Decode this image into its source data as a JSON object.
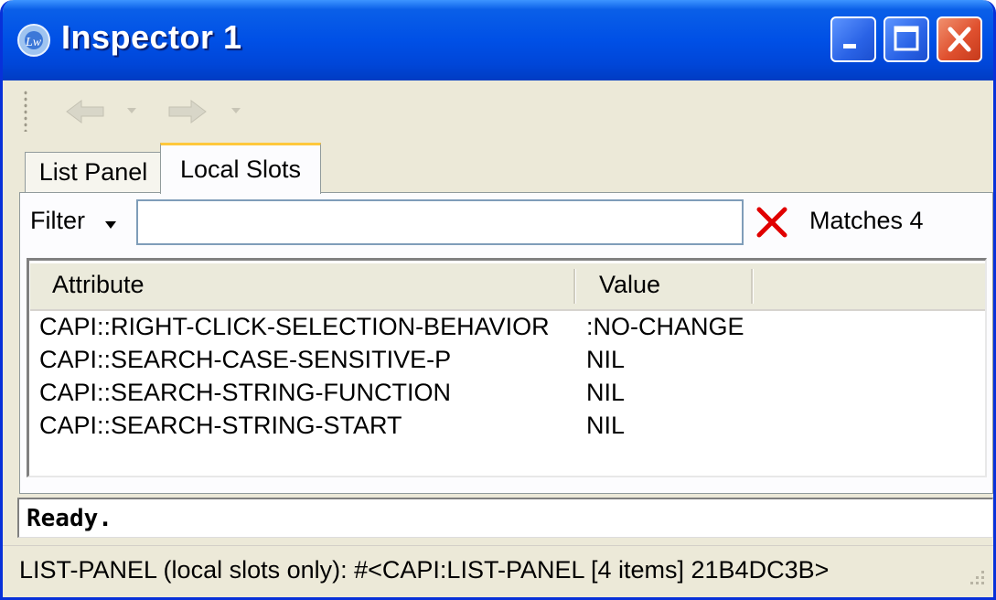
{
  "window": {
    "title": "Inspector 1",
    "app_icon": "lispworks-logo-icon",
    "controls": [
      "minimize-icon",
      "maximize-icon",
      "close-icon"
    ]
  },
  "toolbar": {
    "items": [
      {
        "icon": "back-arrow-icon",
        "enabled": false
      },
      {
        "icon": "dropdown-caret-icon",
        "enabled": false
      },
      {
        "icon": "forward-arrow-icon",
        "enabled": false
      },
      {
        "icon": "dropdown-caret-icon",
        "enabled": false
      }
    ]
  },
  "tabs": [
    {
      "label": "List Panel",
      "active": false
    },
    {
      "label": "Local Slots",
      "active": true
    }
  ],
  "filter": {
    "label": "Filter",
    "value": "",
    "clear_icon": "red-x-icon",
    "matches_text": "Matches 4"
  },
  "table": {
    "columns": [
      "Attribute",
      "Value"
    ],
    "rows": [
      {
        "attribute": "CAPI::RIGHT-CLICK-SELECTION-BEHAVIOR",
        "value": ":NO-CHANGE"
      },
      {
        "attribute": "CAPI::SEARCH-CASE-SENSITIVE-P",
        "value": "NIL"
      },
      {
        "attribute": "CAPI::SEARCH-STRING-FUNCTION",
        "value": "NIL"
      },
      {
        "attribute": "CAPI::SEARCH-STRING-START",
        "value": "NIL"
      }
    ]
  },
  "echo_area": {
    "text": "Ready."
  },
  "status_bar": {
    "text": "LIST-PANEL (local slots only): #<CAPI:LIST-PANEL [4 items] 21B4DC3B>"
  },
  "colors": {
    "titlebar_blue": "#0050e6",
    "close_red": "#e0512f",
    "active_tab_accent": "#ffc83c",
    "clear_x_red": "#e00000"
  }
}
